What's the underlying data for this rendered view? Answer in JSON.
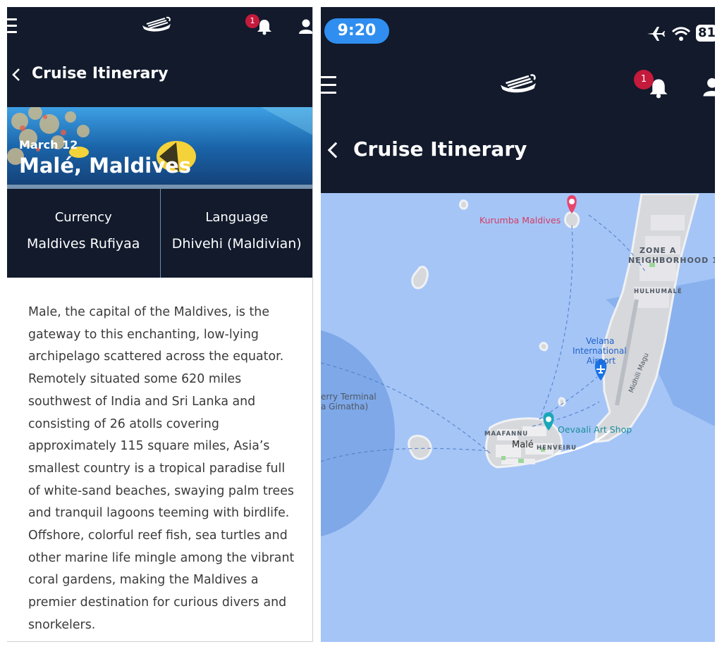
{
  "left": {
    "header": {
      "notification_count": "1",
      "title": "Cruise Itinerary"
    },
    "hero": {
      "date": "March 12",
      "port": "Malé, Maldives"
    },
    "info": {
      "currency_label": "Currency",
      "currency_value": "Maldives Rufiyaa",
      "language_label": "Language",
      "language_value": "Dhivehi (Maldivian)"
    },
    "description": "Male, the capital of the Maldives, is the gateway to this enchanting, low-lying archipelago scattered across the equator. Remotely situated some 620 miles southwest of India and Sri Lanka and consisting of 26 atolls covering approximately 115 square miles, Asia’s smallest country is a tropical paradise full of white-sand beaches, swaying palm trees and tranquil lagoons teeming with birdlife. Offshore, colorful reef fish, sea turtles and other marine life mingle among the vibrant coral gardens, making the Maldives a premier destination for curious divers and snorkelers."
  },
  "right": {
    "status_bar": {
      "time": "9:20",
      "battery": "81"
    },
    "header": {
      "notification_count": "1",
      "title": "Cruise Itinerary"
    },
    "map": {
      "kurumba": "Kurumba Maldives",
      "zone_a_line1": "ZONE A",
      "zone_a_line2": "NEIGHBORHOOD 1",
      "hulhumale": "HULHUMALÉ",
      "airport_line1": "Velana",
      "airport_line2": "International",
      "airport_line3": "Airport",
      "ferry_line1": "erry Terminal",
      "ferry_line2": "a Gimatha)",
      "midhili": "Midhili Magu",
      "art_shop": "Oevaali Art Shop",
      "maafannu": "MAAFANNU",
      "male": "Malé",
      "henveiru": "HENVEIRU"
    }
  },
  "colors": {
    "header_bg": "#121a2c",
    "badge": "#c41a3b",
    "sea": "#a5c5f7",
    "pin_red": "#e8446d",
    "pin_teal": "#1aa8b8",
    "pin_blue": "#1a73e8"
  }
}
